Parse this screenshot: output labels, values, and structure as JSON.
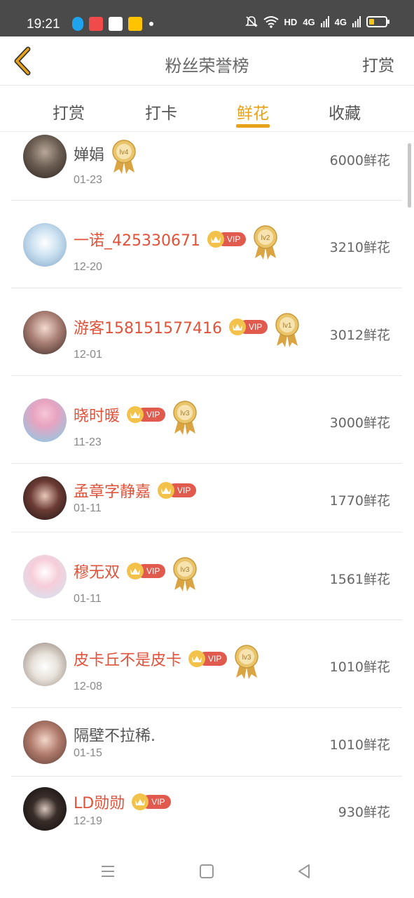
{
  "status_bar": {
    "time": "19:21",
    "network_label": "HD",
    "signal_1": "4G",
    "signal_2": "4G"
  },
  "header": {
    "title": "粉丝荣誉榜",
    "right_action": "打赏",
    "back_icon": "chevron-left-icon"
  },
  "tabs": [
    {
      "label": "打赏",
      "active": false
    },
    {
      "label": "打卡",
      "active": false
    },
    {
      "label": "鲜花",
      "active": true
    },
    {
      "label": "收藏",
      "active": false
    }
  ],
  "colors": {
    "accent": "#e8a21a",
    "vip_name": "#e0533b",
    "vip_pill": "#e05a4e",
    "crown": "#f3c24a",
    "medal_gold": "#e0b25a"
  },
  "fans": [
    {
      "name": "婵娟",
      "vip": false,
      "level": "lv4",
      "date": "01-23",
      "amount": "6000鲜花"
    },
    {
      "name": "一诺_425330671",
      "vip": true,
      "level": "lv2",
      "date": "12-20",
      "amount": "3210鲜花"
    },
    {
      "name": "游客158151577416",
      "vip": true,
      "level": "lv1",
      "date": "12-01",
      "amount": "3012鲜花"
    },
    {
      "name": "晓时暖",
      "vip": true,
      "level": "lv3",
      "date": "11-23",
      "amount": "3000鲜花"
    },
    {
      "name": "孟章字静嘉",
      "vip": true,
      "level": "",
      "date": "01-11",
      "amount": "1770鲜花"
    },
    {
      "name": "穆无双",
      "vip": true,
      "level": "lv3",
      "date": "01-11",
      "amount": "1561鲜花"
    },
    {
      "name": "皮卡丘不是皮卡",
      "vip": true,
      "level": "lv3",
      "date": "12-08",
      "amount": "1010鲜花"
    },
    {
      "name": "隔壁不拉稀.",
      "vip": false,
      "level": "",
      "date": "01-15",
      "amount": "1010鲜花"
    },
    {
      "name": "LD勋勋",
      "vip": true,
      "level": "",
      "date": "12-19",
      "amount": "930鲜花"
    }
  ],
  "vip_label": "VIP",
  "nav": {
    "menu_icon": "menu-icon",
    "home_icon": "home-square-icon",
    "back_icon": "back-triangle-icon"
  }
}
